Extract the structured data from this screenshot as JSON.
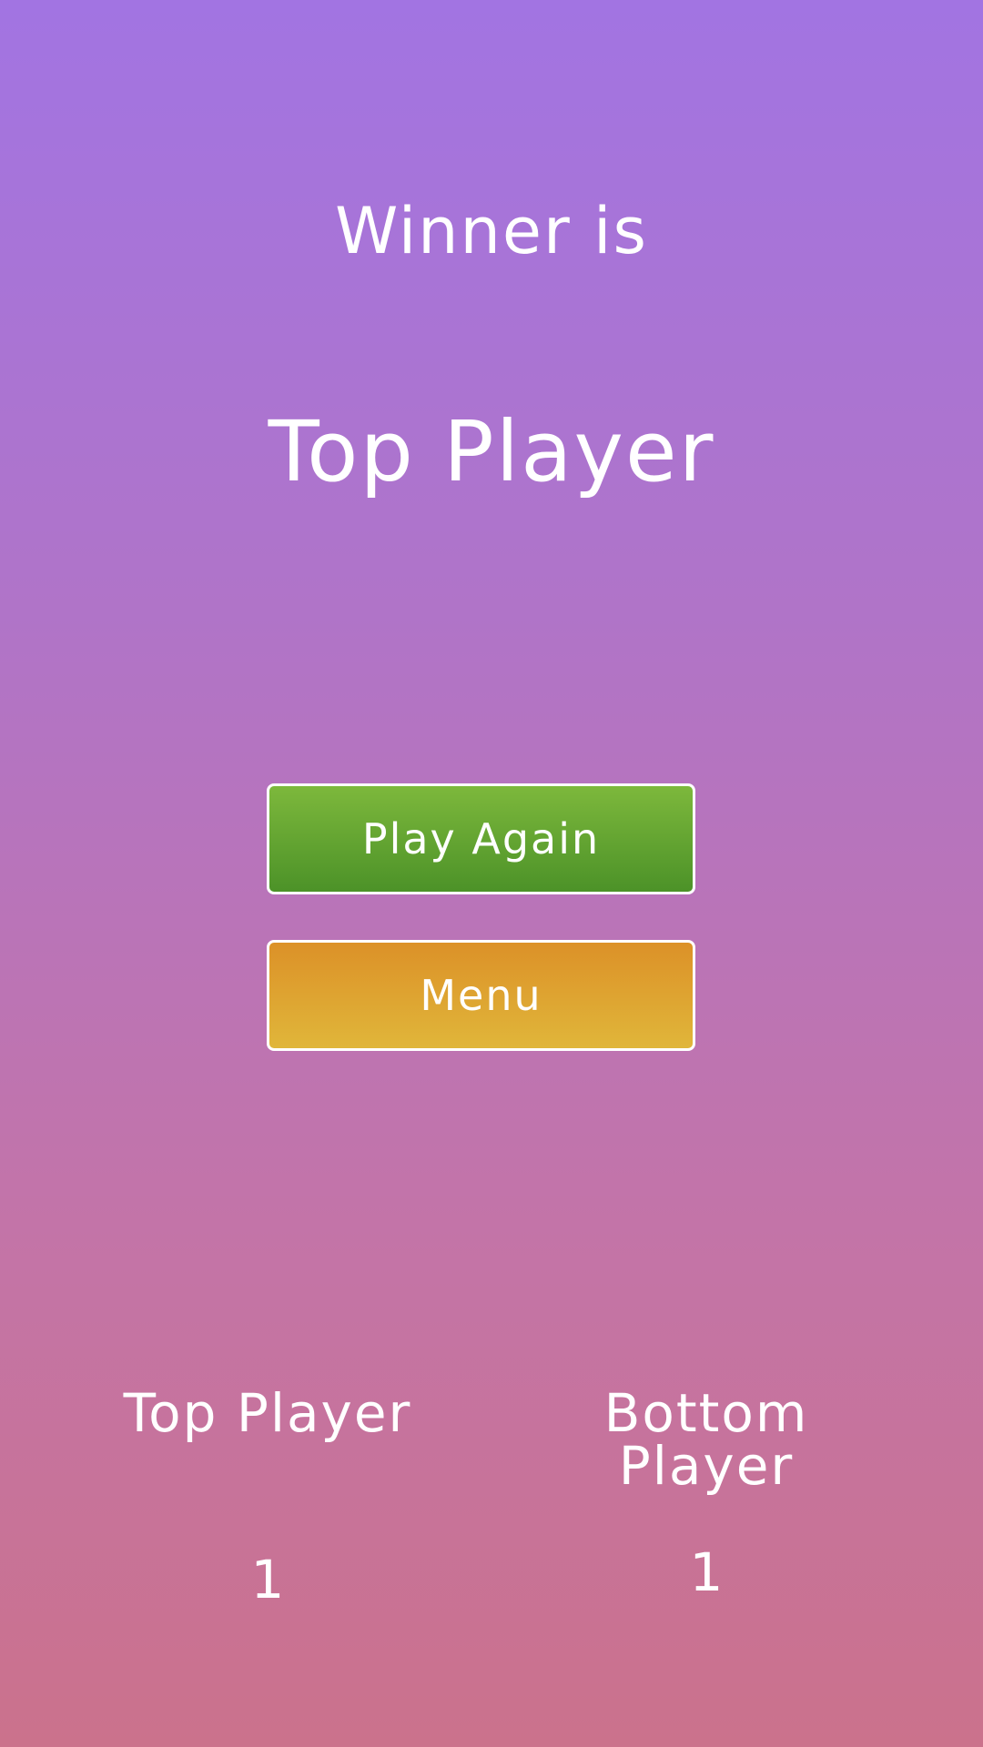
{
  "result": {
    "label": "Winner is",
    "winner": "Top Player"
  },
  "buttons": {
    "play_again": "Play Again",
    "menu": "Menu"
  },
  "scores": [
    {
      "player": "Top Player",
      "value": "1"
    },
    {
      "player": "Bottom Player",
      "value": "1"
    }
  ],
  "colors": {
    "play_again": "#5fa632",
    "menu": "#dea431",
    "background_top": "#a274e2",
    "background_bottom": "#cb728c"
  }
}
